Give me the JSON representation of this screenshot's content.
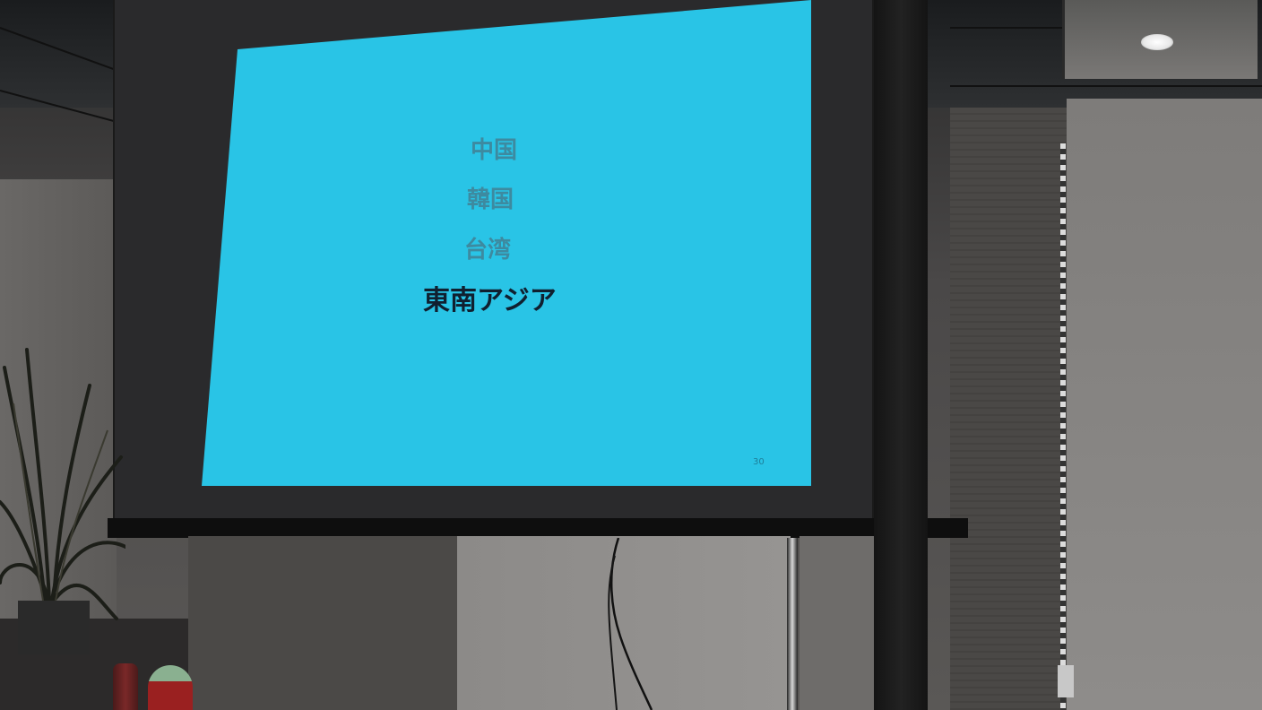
{
  "slide": {
    "items": [
      {
        "label": "中国",
        "state": "muted"
      },
      {
        "label": "韓国",
        "state": "muted"
      },
      {
        "label": "台湾",
        "state": "muted"
      },
      {
        "label": "東南アジア",
        "state": "active"
      }
    ],
    "page_number": "30",
    "background_color": "#29c4e6",
    "muted_text_color": "#3d8aa0",
    "active_text_color": "#102030"
  }
}
